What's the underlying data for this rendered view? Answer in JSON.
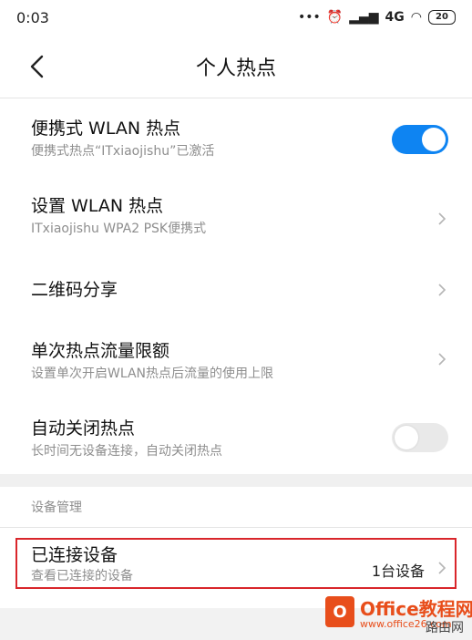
{
  "status_bar": {
    "time": "0:03",
    "dots": "•••",
    "network": "4G",
    "battery": "20"
  },
  "header": {
    "title": "个人热点"
  },
  "rows": [
    {
      "title": "便携式 WLAN 热点",
      "subtitle": "便携式热点“ITxiaojishu”已激活",
      "toggle": true
    },
    {
      "title": "设置 WLAN 热点",
      "subtitle": "ITxiaojishu WPA2 PSK便携式"
    },
    {
      "title": "二维码分享"
    },
    {
      "title": "单次热点流量限额",
      "subtitle": "设置单次开启WLAN热点后流量的使用上限"
    },
    {
      "title": "自动关闭热点",
      "subtitle": "长时间无设备连接，自动关闭热点",
      "toggle": false
    }
  ],
  "device_section": {
    "label": "设备管理",
    "connected": {
      "title": "已连接设备",
      "subtitle": "查看已连接的设备",
      "value": "1台设备"
    }
  },
  "watermark": {
    "name": "Office教程网",
    "url": "www.office26.com",
    "corner": "路由网"
  },
  "colors": {
    "accent": "#0e84f2",
    "highlight": "#d9262b",
    "watermark": "#e84e1b"
  }
}
